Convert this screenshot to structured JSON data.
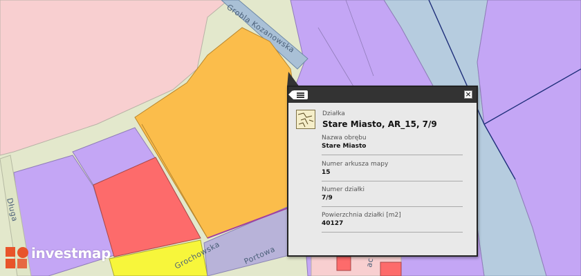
{
  "map": {
    "streets": [
      "Grobla Kozanowska",
      "Długa",
      "Portowa",
      "Grochowska",
      "ac"
    ],
    "colors": {
      "residential": "#f8cfd0",
      "green": "#e3e8cc",
      "lilac": "#c4a6f5",
      "orange": "#fbbd4b",
      "red": "#fd6b6b",
      "yellow": "#f7f63b",
      "water": "#b6ccdf",
      "road": "#dfe5c6"
    }
  },
  "popup": {
    "layer_type": "Działka",
    "title": "Stare Miasto, AR_15, 7/9",
    "fields": [
      {
        "label": "Nazwa obrębu",
        "value": "Stare Miasto"
      },
      {
        "label": "Numer arkusza mapy",
        "value": "15"
      },
      {
        "label": "Numer działki",
        "value": "7/9"
      },
      {
        "label": "Powierzchnia działki [m2]",
        "value": "40127"
      }
    ],
    "close_icon": "close-icon",
    "list_icon": "list-icon"
  },
  "brand": {
    "logo_text": "investmap",
    "logo_color": "#e8542a"
  }
}
